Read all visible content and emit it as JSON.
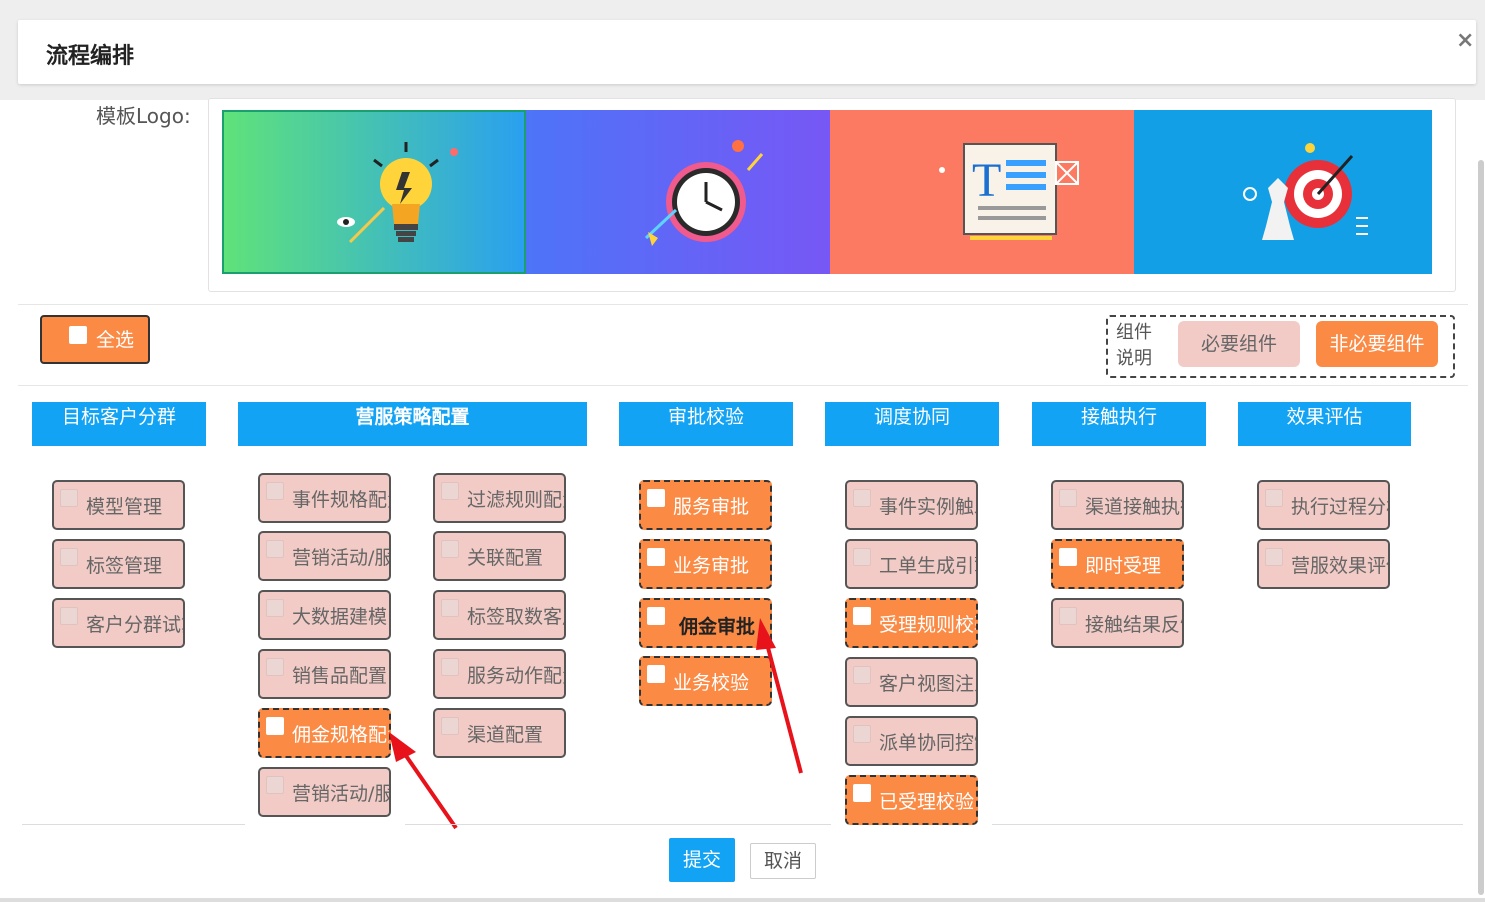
{
  "dialog": {
    "title": "流程编排",
    "close_glyph": "×"
  },
  "template_logo": {
    "label": "模板Logo:",
    "banners": [
      {
        "name": "lightbulb-banner",
        "icon": "lightbulb-icon"
      },
      {
        "name": "clock-banner",
        "icon": "clock-icon"
      },
      {
        "name": "document-banner",
        "icon": "text-document-icon"
      },
      {
        "name": "target-banner",
        "icon": "target-icon"
      }
    ]
  },
  "select_all": {
    "label": "全选"
  },
  "legend": {
    "title": "组件说明",
    "required_label": "必要组件",
    "optional_label": "非必要组件",
    "required_color": "#f2cbc6",
    "optional_color": "#fb8a45"
  },
  "columns": [
    {
      "title": "目标客户分群",
      "items": [
        "模型管理",
        "标签管理",
        "客户分群试算"
      ]
    },
    {
      "title": "营服策略配置",
      "items": [
        "事件规格配置",
        "过滤规则配置",
        "营销活动/服务",
        "关联配置",
        "大数据建模",
        "标签取数客户",
        "销售品配置",
        "服务动作配置",
        "佣金规格配置",
        "渠道配置",
        "营销活动/服务"
      ]
    },
    {
      "title": "审批校验",
      "items": [
        "服务审批",
        "业务审批",
        "佣金审批",
        "业务校验"
      ]
    },
    {
      "title": "调度协同",
      "items": [
        "事件实例触发",
        "工单生成引擎",
        "受理规则校验",
        "客户视图注入",
        "派单协同控制",
        "已受理校验"
      ]
    },
    {
      "title": "接触执行",
      "items": [
        "渠道接触执行",
        "即时受理",
        "接触结果反馈"
      ]
    },
    {
      "title": "效果评估",
      "items": [
        "执行过程分析",
        "营服效果评估"
      ]
    }
  ],
  "footer": {
    "submit_label": "提交",
    "cancel_label": "取消"
  },
  "colors": {
    "header_blue": "#12a3f5",
    "annotation_arrow": "#e8121b"
  }
}
